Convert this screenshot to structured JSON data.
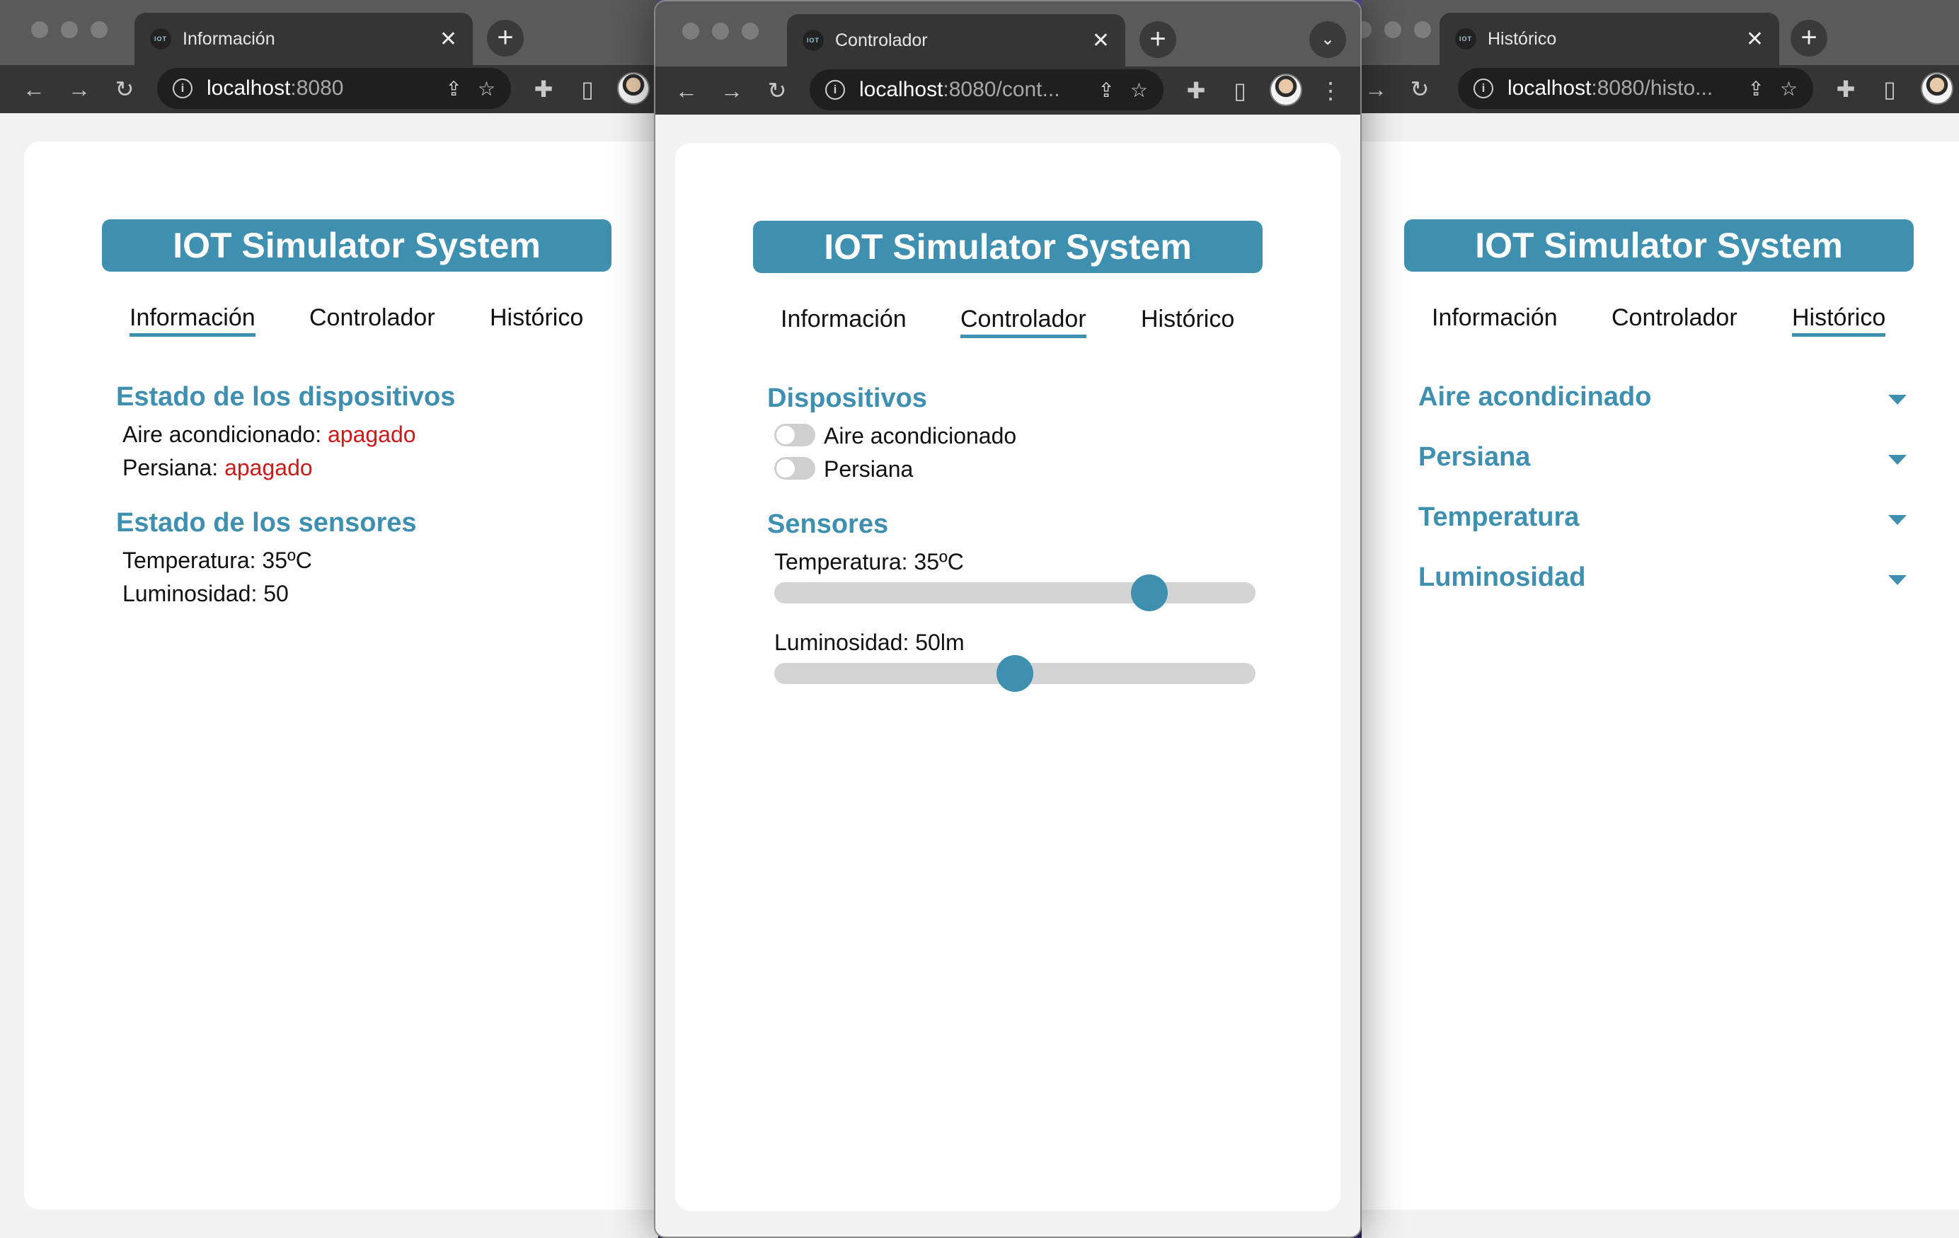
{
  "app_title": "IOT Simulator System",
  "nav": {
    "info": "Información",
    "controller": "Controlador",
    "history": "Histórico"
  },
  "favicon": "IOT",
  "colors": {
    "accent": "#3e8fb0",
    "off": "#cc1a1a",
    "chrome": "#353535"
  },
  "icons": [
    "back-icon",
    "forward-icon",
    "reload-icon",
    "info-icon",
    "share-icon",
    "star-icon",
    "extensions-icon",
    "side-panel-icon",
    "kebab-menu-icon",
    "close-icon",
    "plus-icon",
    "chevron-down-icon"
  ],
  "windows": {
    "info": {
      "tab_title": "Información",
      "url_host": "localhost",
      "url_rest": ":8080",
      "devices_title": "Estado de los dispositivos",
      "devices": [
        {
          "label": "Aire acondicionado:",
          "state": "apagado"
        },
        {
          "label": "Persiana:",
          "state": "apagado"
        }
      ],
      "sensors_title": "Estado de los sensores",
      "sensors": [
        {
          "text": "Temperatura: 35ºC"
        },
        {
          "text": "Luminosidad: 50"
        }
      ]
    },
    "controller": {
      "tab_title": "Controlador",
      "url_host": "localhost",
      "url_rest": ":8080/cont...",
      "devices_title": "Dispositivos",
      "devices": [
        {
          "label": "Aire acondicionado",
          "on": false
        },
        {
          "label": "Persiana",
          "on": false
        }
      ],
      "sensors_title": "Sensores",
      "sensors": [
        {
          "label": "Temperatura: 35ºC",
          "fraction": 0.78
        },
        {
          "label": "Luminosidad: 50lm",
          "fraction": 0.5
        }
      ]
    },
    "history": {
      "tab_title": "Histórico",
      "url_host": "localhost",
      "url_rest": ":8080/histo...",
      "items": [
        "Aire acondicinado",
        "Persiana",
        "Temperatura",
        "Luminosidad"
      ]
    }
  }
}
